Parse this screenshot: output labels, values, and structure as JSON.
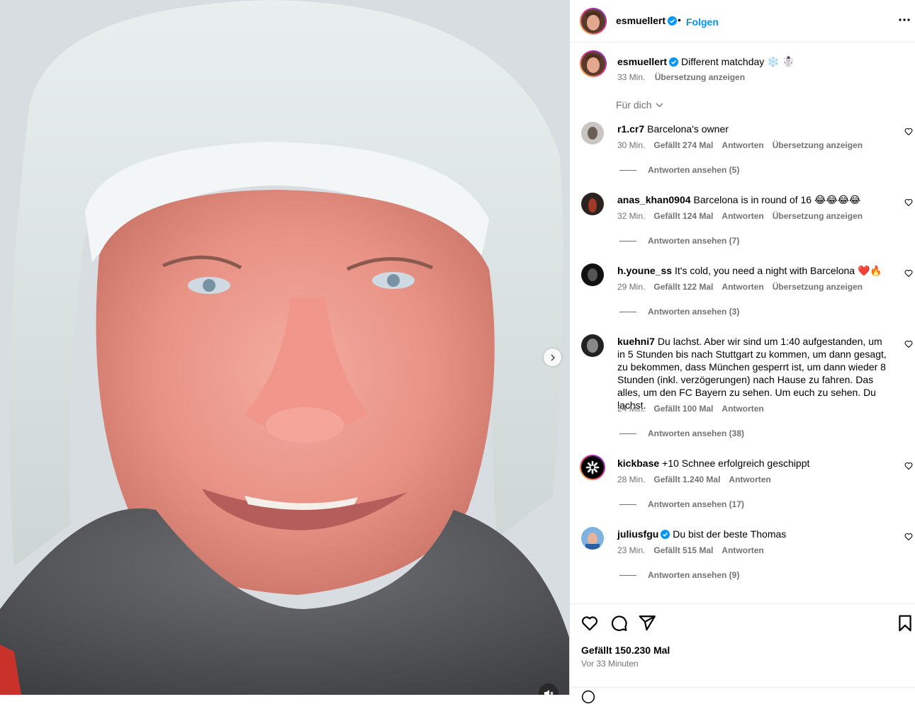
{
  "post": {
    "author": "esmuellert",
    "follow_label": "Folgen",
    "separator": "•",
    "caption": "Different matchday ❄️ ☃️",
    "caption_time": "33 Min.",
    "caption_translate": "Übersetzung anzeigen",
    "sort_label": "Für dich"
  },
  "comments": [
    {
      "user": "r1.cr7",
      "verified": false,
      "text": "Barcelona's owner",
      "time": "30 Min.",
      "likes": "Gefällt 274 Mal",
      "reply": "Antworten",
      "translate": "Übersetzung anzeigen",
      "replies": "Antworten ansehen (5)",
      "avatar_color": "#5b5550"
    },
    {
      "user": "anas_khan0904",
      "verified": false,
      "text": "Barcelona is in round of 16 😂😂😂😂",
      "time": "32 Min.",
      "likes": "Gefällt 124 Mal",
      "reply": "Antworten",
      "translate": "Übersetzung anzeigen",
      "replies": "Antworten ansehen (7)",
      "avatar_color": "#7a3a2a"
    },
    {
      "user": "h.youne_ss",
      "verified": false,
      "text": "It's cold, you need a night with Barcelona ❤️🔥",
      "time": "29 Min.",
      "likes": "Gefällt 122 Mal",
      "reply": "Antworten",
      "translate": "Übersetzung anzeigen",
      "replies": "Antworten ansehen (3)",
      "avatar_color": "#111111"
    },
    {
      "user": "kuehni7",
      "verified": false,
      "text": "Du lachst. Aber wir sind um 1:40 aufgestanden, um in 5 Stunden bis nach Stuttgart zu kommen, um dann gesagt, zu bekommen, dass München gesperrt ist, um dann wieder 8 Stunden (inkl. verzögerungen) nach Hause zu fahren. Das alles, um den FC Bayern zu sehen. Um euch zu sehen. Du lachst.",
      "time": "24 Min.",
      "likes": "Gefällt 100 Mal",
      "reply": "Antworten",
      "translate": "",
      "replies": "Antworten ansehen (38)",
      "avatar_color": "#2b2b2b"
    },
    {
      "user": "kickbase",
      "verified": false,
      "text": "+10 Schnee erfolgreich geschippt",
      "time": "28 Min.",
      "likes": "Gefällt 1.240 Mal",
      "reply": "Antworten",
      "translate": "",
      "replies": "Antworten ansehen (17)",
      "avatar_color": "#000000"
    },
    {
      "user": "juliusfgu",
      "verified": true,
      "text": "Du bist der beste Thomas",
      "time": "23 Min.",
      "likes": "Gefällt 515 Mal",
      "reply": "Antworten",
      "translate": "",
      "replies": "Antworten ansehen (9)",
      "avatar_color": "#3d6fa8"
    }
  ],
  "footer": {
    "likes": "Gefällt 150.230 Mal",
    "time_ago": "Vor 33 Minuten"
  },
  "colors": {
    "link_blue": "#0095f6",
    "verified_blue": "#0095f6",
    "muted_text": "#737373"
  }
}
